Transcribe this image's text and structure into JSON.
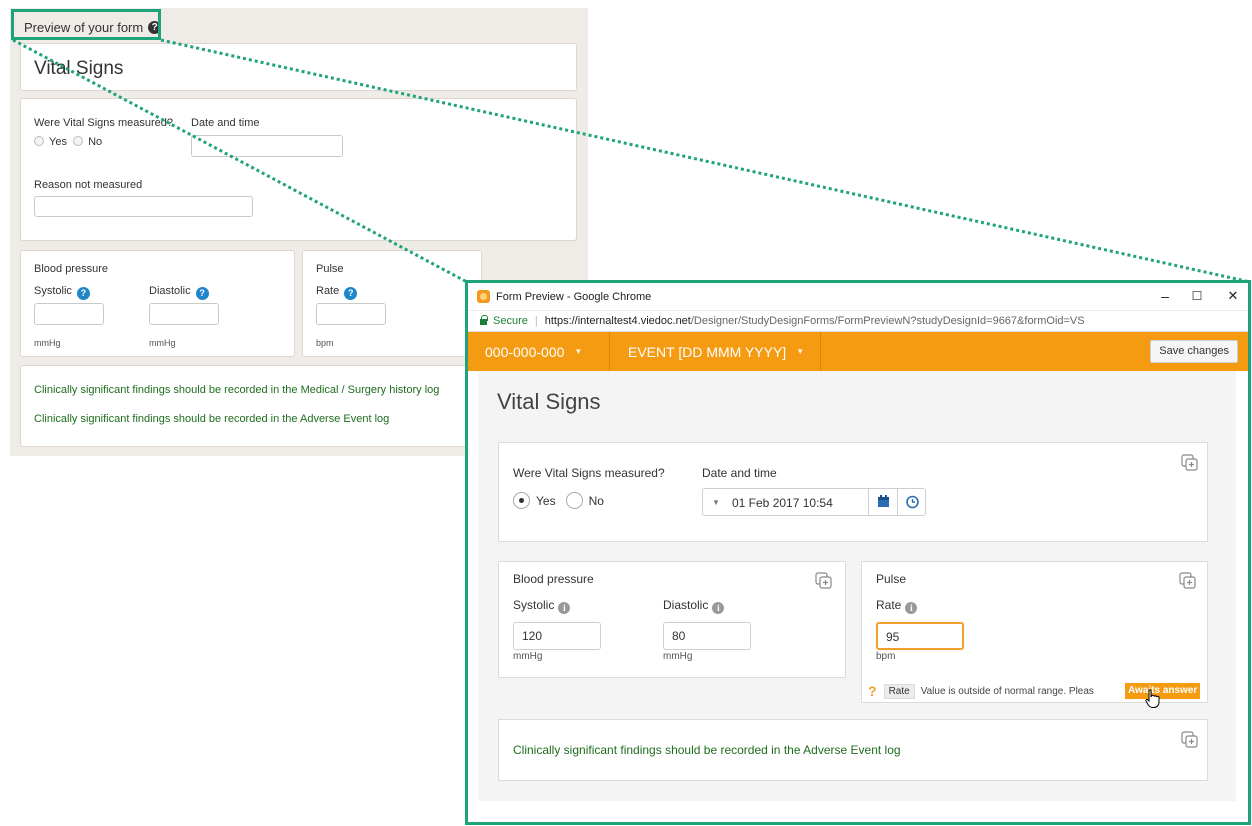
{
  "background_preview": {
    "header_label": "Preview of your form",
    "form_title": "Vital Signs",
    "q_measured": "Were Vital Signs measured?",
    "opt_yes": "Yes",
    "opt_no": "No",
    "date_time_label": "Date and time",
    "reason_label": "Reason not measured",
    "bp_label": "Blood pressure",
    "systolic_label": "Systolic",
    "diastolic_label": "Diastolic",
    "unit_mmhg": "mmHg",
    "pulse_label": "Pulse",
    "rate_label": "Rate",
    "unit_bpm": "bpm",
    "note_medical": "Clinically significant findings should be recorded in the Medical / Surgery history log",
    "note_adverse": "Clinically significant findings should be recorded in the Adverse Event log"
  },
  "window": {
    "title": "Form Preview - Google Chrome",
    "minimize": "–",
    "maximize": "☐",
    "close": "✕",
    "secure_label": "Secure",
    "url_host": "https://internaltest4.viedoc.net",
    "url_path": "/Designer/StudyDesignForms/FormPreviewN?studyDesignId=9667&formOid=VS"
  },
  "toolbar": {
    "subject_id": "000-000-000",
    "event_label": "EVENT [DD MMM YYYY]",
    "save_label": "Save changes"
  },
  "form": {
    "title": "Vital Signs",
    "q_measured": "Were Vital Signs measured?",
    "opt_yes": "Yes",
    "opt_no": "No",
    "selected": "Yes",
    "date_time_label": "Date and time",
    "date_time_value": "01 Feb 2017 10:54",
    "bp_label": "Blood pressure",
    "systolic_label": "Systolic",
    "systolic_value": "120",
    "diastolic_label": "Diastolic",
    "diastolic_value": "80",
    "unit_mmhg": "mmHg",
    "pulse_label": "Pulse",
    "rate_label": "Rate",
    "rate_value": "95",
    "unit_bpm": "bpm",
    "query_field": "Rate",
    "query_text": "Value is outside of normal range. Pleas",
    "query_status": "Awaits answer",
    "note_adverse": "Clinically significant findings should be recorded in the Adverse Event log"
  },
  "colors": {
    "accent_orange": "#f59b12",
    "callout_green": "#1fa37a",
    "note_green": "#1f6d1f",
    "help_blue": "#1e86c9"
  }
}
